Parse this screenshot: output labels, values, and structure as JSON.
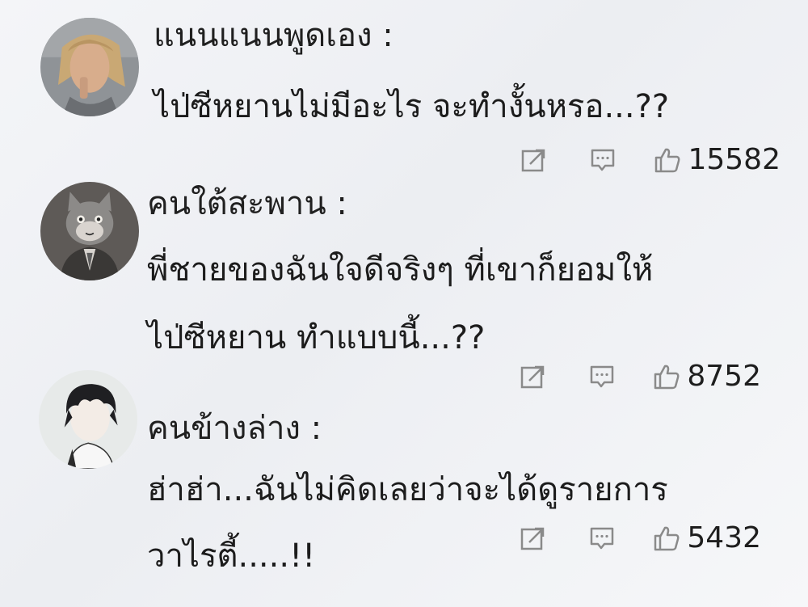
{
  "comments": [
    {
      "name": "แนนแนนพูดเอง :",
      "lines": [
        "ไป่ซีหยานไม่มีอะไร จะทำงั้นหรอ...??"
      ],
      "likes": "15582",
      "avatar": "avatar-blond-man"
    },
    {
      "name": "คนใต้สะพาน :",
      "lines": [
        "พี่ชายของฉันใจดีจริงๆ ที่เขาก็ยอมให้",
        "ไป่ซีหยาน ทำแบบนี้...??"
      ],
      "likes": "8752",
      "avatar": "avatar-cat-in-suit"
    },
    {
      "name": "คนข้างล่าง :",
      "lines": [
        "ฮ่าฮ่า...ฉันไม่คิดเลยว่าจะได้ดูรายการ",
        "วาไรตี้.....!!"
      ],
      "likes": "5432",
      "avatar": "avatar-anime-boy"
    }
  ],
  "icons": {
    "share": "share-icon",
    "reply": "comment-icon",
    "like": "thumbs-up-icon"
  },
  "colors": {
    "background": "#eef0f3",
    "text": "#1e1e1e",
    "icon": "#8a8a8a"
  }
}
